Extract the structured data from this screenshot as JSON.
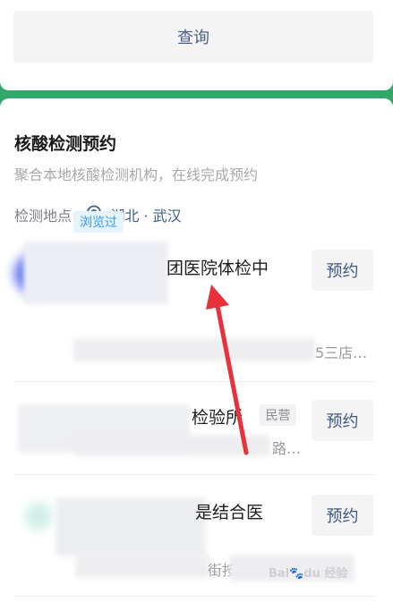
{
  "query": {
    "label": "查询"
  },
  "section": {
    "title": "核酸检测预约",
    "subtitle": "聚合本地核酸检测机构，在线完成预约",
    "location_label": "检测地点:",
    "location_value": "湖北 · 武汉"
  },
  "items": [
    {
      "name_visible": "团医院体检中",
      "tag": "浏览过",
      "address_visible": "5三店…",
      "book_label": "预约"
    },
    {
      "name_visible": "检验所",
      "tag": "民营",
      "address_visible": "路…",
      "book_label": "预约"
    },
    {
      "name_visible": "是结合医",
      "address_visible": "街按",
      "book_label": "预约"
    }
  ],
  "watermark": "Bai du 经验",
  "colors": {
    "accent_green": "#32a868",
    "link_blue": "#3e5d8c",
    "arrow_red": "#e8313a"
  }
}
